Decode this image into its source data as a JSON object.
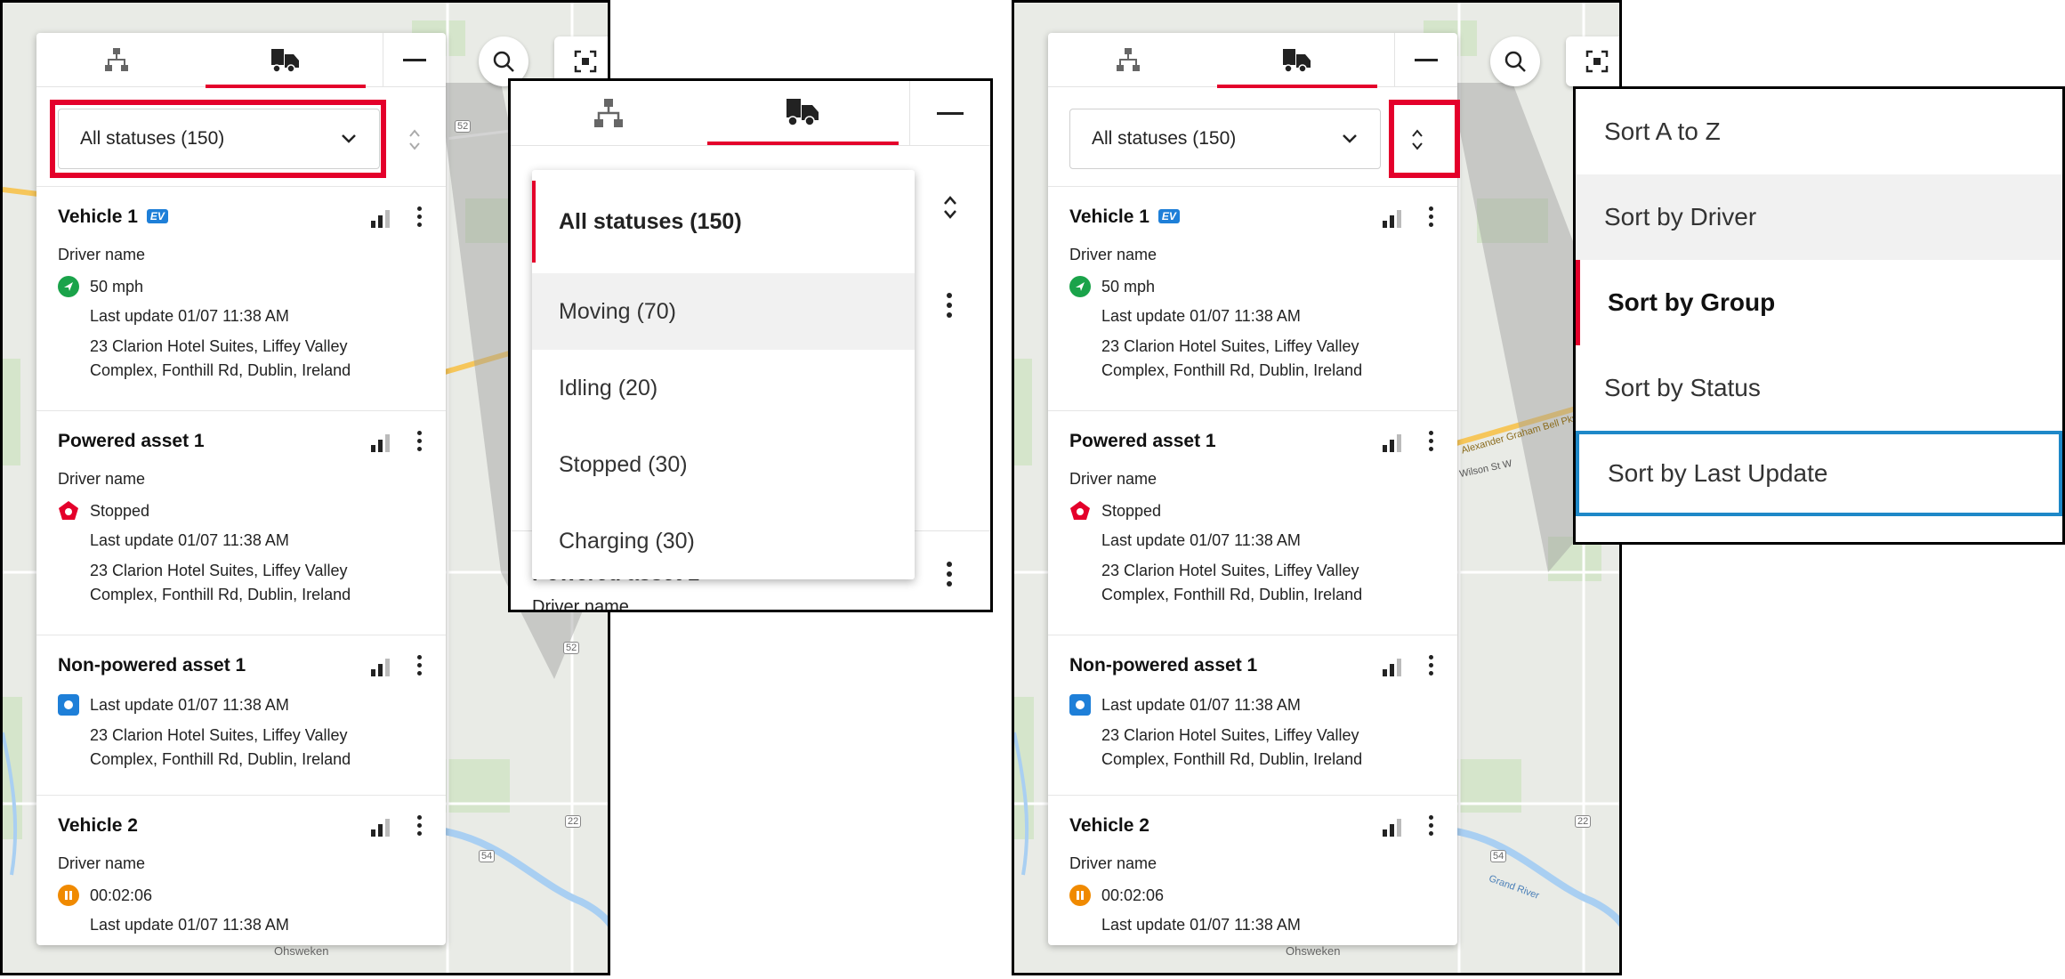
{
  "map_labels": {
    "ohsweken": "Ohsweken",
    "route_52": "52",
    "route_54": "54",
    "route_22": "22",
    "grand_river": "Grand River",
    "alexander_graham_bell_pkwy": "Alexander Graham Bell Pkwy",
    "wilson_st_w": "Wilson St W"
  },
  "filter": {
    "selected": "All statuses (150)",
    "options": [
      "All statuses (150)",
      "Moving (70)",
      "Idling (20)",
      "Stopped (30)",
      "Charging (30)"
    ]
  },
  "sort": {
    "options": [
      "Sort A to Z",
      "Sort by Driver",
      "Sort by Group",
      "Sort by Status",
      "Sort by Last Update"
    ],
    "selected": "Sort by Group",
    "hovered": "Sort by Driver",
    "focused": "Sort by Last Update"
  },
  "assets": [
    {
      "name": "Vehicle 1",
      "ev_badge": "EV",
      "driver": "Driver name",
      "status_icon": "moving-icon",
      "status_text": "50 mph",
      "last_update": "Last update 01/07 11:38 AM",
      "address1": "23 Clarion Hotel Suites, Liffey Valley",
      "address2": "Complex, Fonthill Rd, Dublin, Ireland"
    },
    {
      "name": "Powered asset 1",
      "driver": "Driver name",
      "status_icon": "stopped-icon",
      "status_text": "Stopped",
      "last_update": "Last update 01/07 11:38 AM",
      "address1": "23 Clarion Hotel Suites, Liffey Valley",
      "address2": "Complex, Fonthill Rd, Dublin, Ireland"
    },
    {
      "name": "Non-powered asset 1",
      "status_icon": "non-powered-icon",
      "last_update": "Last update 01/07 11:38 AM",
      "address1": "23 Clarion Hotel Suites, Liffey Valley",
      "address2": "Complex, Fonthill Rd, Dublin, Ireland"
    },
    {
      "name": "Vehicle 2",
      "driver": "Driver name",
      "status_icon": "idling-icon",
      "status_text": "00:02:06",
      "last_update": "Last update 01/07 11:38 AM"
    }
  ],
  "popup_peek": {
    "name": "Powered asset 1",
    "driver": "Driver name"
  },
  "colors": {
    "accent_red": "#e4002b",
    "moving": "#1aa34a",
    "stopped": "#e4002b",
    "non_powered": "#1e7fd8",
    "idling": "#f08a00",
    "focus_blue": "#1e88c8"
  }
}
